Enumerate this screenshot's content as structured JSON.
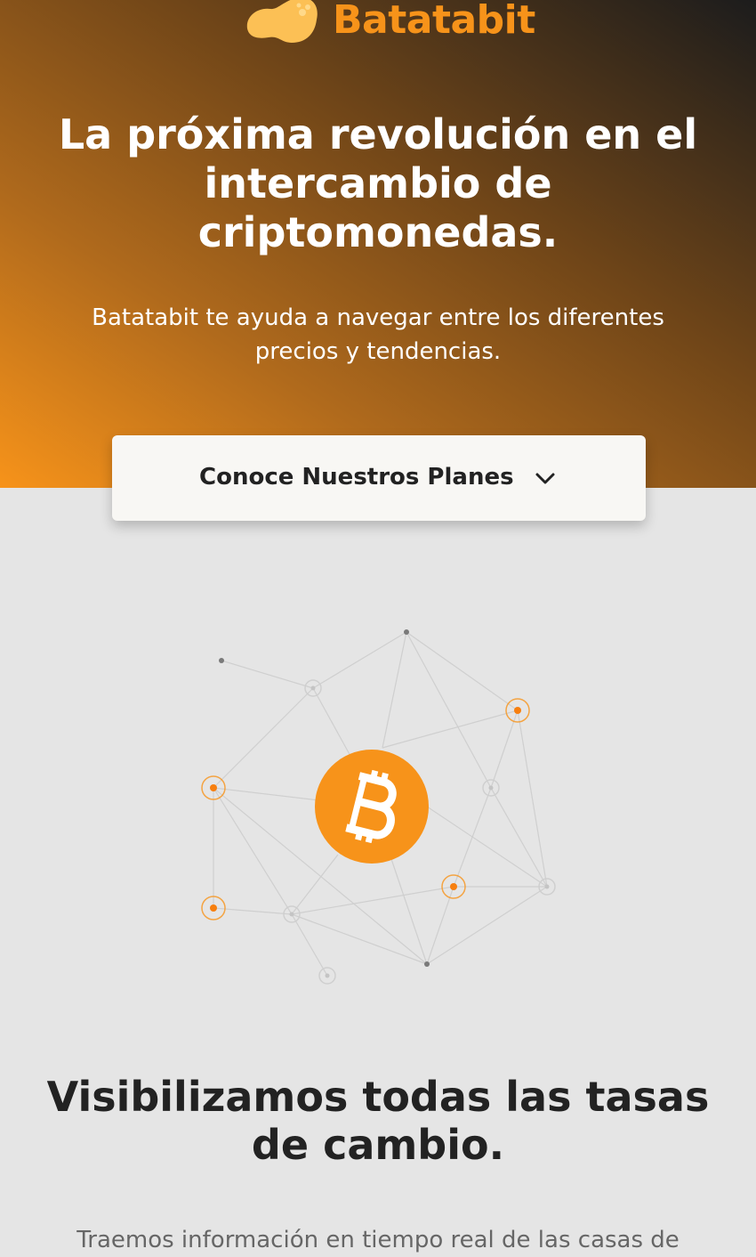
{
  "brand": {
    "name": "Batatabit",
    "accent_color": "#f7931a"
  },
  "hero": {
    "title": "La próxima revolución en el intercambio de criptomonedas.",
    "subtitle": "Batatabit te ayuda a navegar entre los diferentes precios y tendencias.",
    "cta_label": "Conoce Nuestros Planes",
    "cta_icon": "chevron-down-icon"
  },
  "illustration": {
    "icon": "bitcoin-icon"
  },
  "section": {
    "title": "Visibilizamos todas las tasas de cambio.",
    "body": "Traemos información en tiempo real de las casas de"
  }
}
